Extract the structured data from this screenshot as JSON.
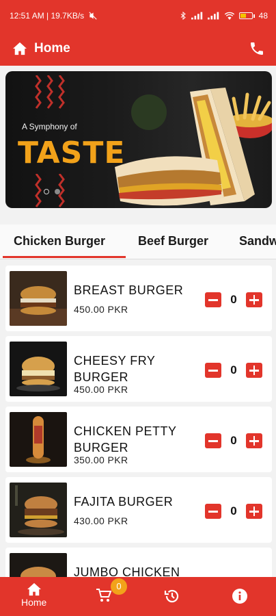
{
  "status_bar": {
    "time_network": "12:51 AM | 19.7KB/s",
    "battery": "48"
  },
  "app_bar": {
    "title": "Home",
    "icons": [
      "home-icon",
      "phone-icon"
    ]
  },
  "banner": {
    "tagline": "A Symphony of",
    "headline": "TASTE",
    "active_slide": 1,
    "slide_count": 2
  },
  "tabs": [
    {
      "label": "Chicken Burger",
      "active": true
    },
    {
      "label": "Beef Burger",
      "active": false
    },
    {
      "label": "Sandw",
      "active": false
    }
  ],
  "products": [
    {
      "name": "BREAST BURGER",
      "price": "450.00 PKR",
      "qty": "0"
    },
    {
      "name": "CHEESY FRY BURGER",
      "price": "450.00 PKR",
      "qty": "0"
    },
    {
      "name": "CHICKEN PETTY BURGER",
      "price": "350.00 PKR",
      "qty": "0"
    },
    {
      "name": "FAJITA BURGER",
      "price": "430.00 PKR",
      "qty": "0"
    },
    {
      "name": "JUMBO CHICKEN",
      "price": "",
      "qty": ""
    }
  ],
  "bottom_nav": {
    "home_label": "Home",
    "cart_count": "0",
    "icons": [
      "home-icon",
      "cart-icon",
      "history-icon",
      "info-icon"
    ]
  },
  "colors": {
    "brand_red": "#e2352b",
    "badge_orange": "#f2a21a"
  }
}
